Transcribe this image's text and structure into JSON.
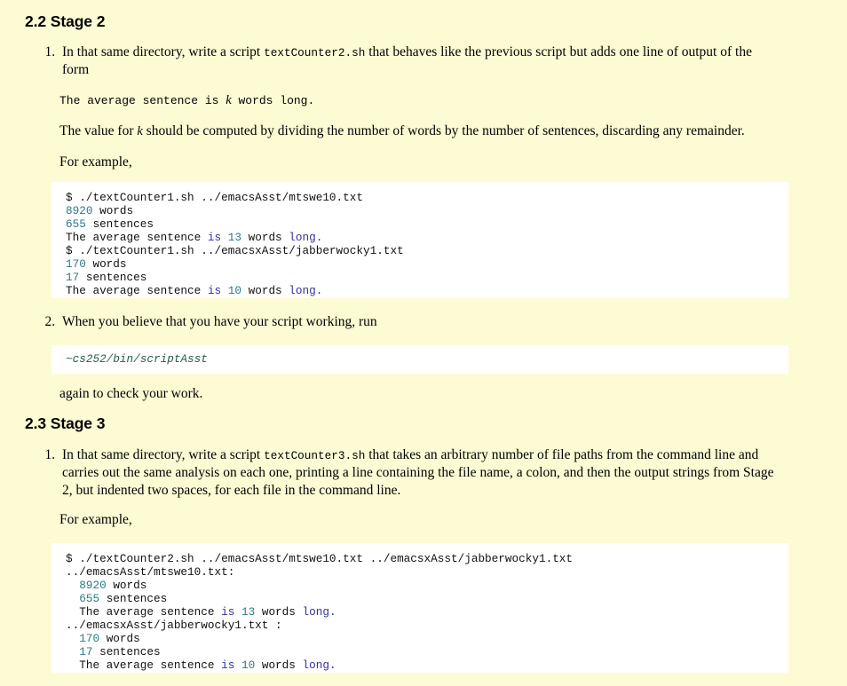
{
  "document": {
    "background_color": "#fdfbd4",
    "code_background_color": "#ffffff"
  },
  "colors": {
    "number_token": "#2b7a88",
    "keyword_token": "#333399",
    "default_token": "#111111",
    "emphasis_token": "#285c4d"
  },
  "sections": [
    {
      "number": "2.2",
      "title": "Stage 2",
      "heading": "2.2 Stage 2"
    },
    {
      "number": "2.3",
      "title": "Stage 3",
      "heading": "2.3 Stage 3"
    }
  ],
  "stage2": {
    "item1": {
      "text_before_code": "In that same directory, write a script ",
      "inline_code": "textCounter2.sh",
      "text_after_code": " that behaves like the previous script but adds one line of output of the form"
    },
    "formula": {
      "prefix": "The average sentence is ",
      "variable": "k",
      "suffix": " words long."
    },
    "value_of_k_prefix": "The value for ",
    "value_of_k_variable": "k",
    "value_of_k_suffix": " should be computed by dividing the number of words by the number of sentences, discarding any remainder.",
    "for_example": "For example,",
    "item2": {
      "text": "When you believe that you have your script working, run"
    },
    "again_text": "again to check your work."
  },
  "stage3": {
    "item1": {
      "text_before_code": "In that same directory, write a script ",
      "inline_code": "textCounter3.sh",
      "text_after_code": " that takes an arbitrary number of file paths from the command line and carries out the same analysis on each one, printing a line containing the file name, a colon, and then the output strings from Stage 2, but indented two spaces, for each file in the command line."
    },
    "for_example": "For example,"
  },
  "code_block_1": {
    "lines": [
      [
        {
          "t": "$ ./textCounter1.sh ../emacsAsst/mtswe10.txt",
          "c": "def"
        }
      ],
      [
        {
          "t": "8920",
          "c": "num"
        },
        {
          "t": " words",
          "c": "def"
        }
      ],
      [
        {
          "t": "655",
          "c": "num"
        },
        {
          "t": " sentences",
          "c": "def"
        }
      ],
      [
        {
          "t": "The average sentence ",
          "c": "def"
        },
        {
          "t": "is",
          "c": "kw"
        },
        {
          "t": " ",
          "c": "def"
        },
        {
          "t": "13",
          "c": "num"
        },
        {
          "t": " words ",
          "c": "def"
        },
        {
          "t": "long.",
          "c": "kw"
        }
      ],
      [
        {
          "t": "$ ./textCounter1.sh ../emacsxAsst/jabberwocky1.txt",
          "c": "def"
        }
      ],
      [
        {
          "t": "170",
          "c": "num"
        },
        {
          "t": " words",
          "c": "def"
        }
      ],
      [
        {
          "t": "17",
          "c": "num"
        },
        {
          "t": " sentences",
          "c": "def"
        }
      ],
      [
        {
          "t": "The average sentence ",
          "c": "def"
        },
        {
          "t": "is",
          "c": "kw"
        },
        {
          "t": " ",
          "c": "def"
        },
        {
          "t": "10",
          "c": "num"
        },
        {
          "t": " words ",
          "c": "def"
        },
        {
          "t": "long.",
          "c": "kw"
        }
      ]
    ]
  },
  "code_block_2": {
    "lines": [
      [
        {
          "t": "~cs252/bin/scriptAsst",
          "c": "em"
        }
      ]
    ]
  },
  "code_block_3": {
    "lines": [
      [
        {
          "t": "$ ./textCounter2.sh ../emacsAsst/mtswe10.txt ../emacsxAsst/jabberwocky1.txt",
          "c": "def"
        }
      ],
      [
        {
          "t": "../emacsAsst/mtswe10.txt:",
          "c": "def"
        }
      ],
      [
        {
          "t": "  ",
          "c": "def"
        },
        {
          "t": "8920",
          "c": "num"
        },
        {
          "t": " words",
          "c": "def"
        }
      ],
      [
        {
          "t": "  ",
          "c": "def"
        },
        {
          "t": "655",
          "c": "num"
        },
        {
          "t": " sentences",
          "c": "def"
        }
      ],
      [
        {
          "t": "  The average sentence ",
          "c": "def"
        },
        {
          "t": "is",
          "c": "kw"
        },
        {
          "t": " ",
          "c": "def"
        },
        {
          "t": "13",
          "c": "num"
        },
        {
          "t": " words ",
          "c": "def"
        },
        {
          "t": "long.",
          "c": "kw"
        }
      ],
      [
        {
          "t": "../emacsxAsst/jabberwocky1.txt :",
          "c": "def"
        }
      ],
      [
        {
          "t": "  ",
          "c": "def"
        },
        {
          "t": "170",
          "c": "num"
        },
        {
          "t": " words",
          "c": "def"
        }
      ],
      [
        {
          "t": "  ",
          "c": "def"
        },
        {
          "t": "17",
          "c": "num"
        },
        {
          "t": " sentences",
          "c": "def"
        }
      ],
      [
        {
          "t": "  The average sentence ",
          "c": "def"
        },
        {
          "t": "is",
          "c": "kw"
        },
        {
          "t": " ",
          "c": "def"
        },
        {
          "t": "10",
          "c": "num"
        },
        {
          "t": " words ",
          "c": "def"
        },
        {
          "t": "long.",
          "c": "kw"
        }
      ]
    ]
  }
}
